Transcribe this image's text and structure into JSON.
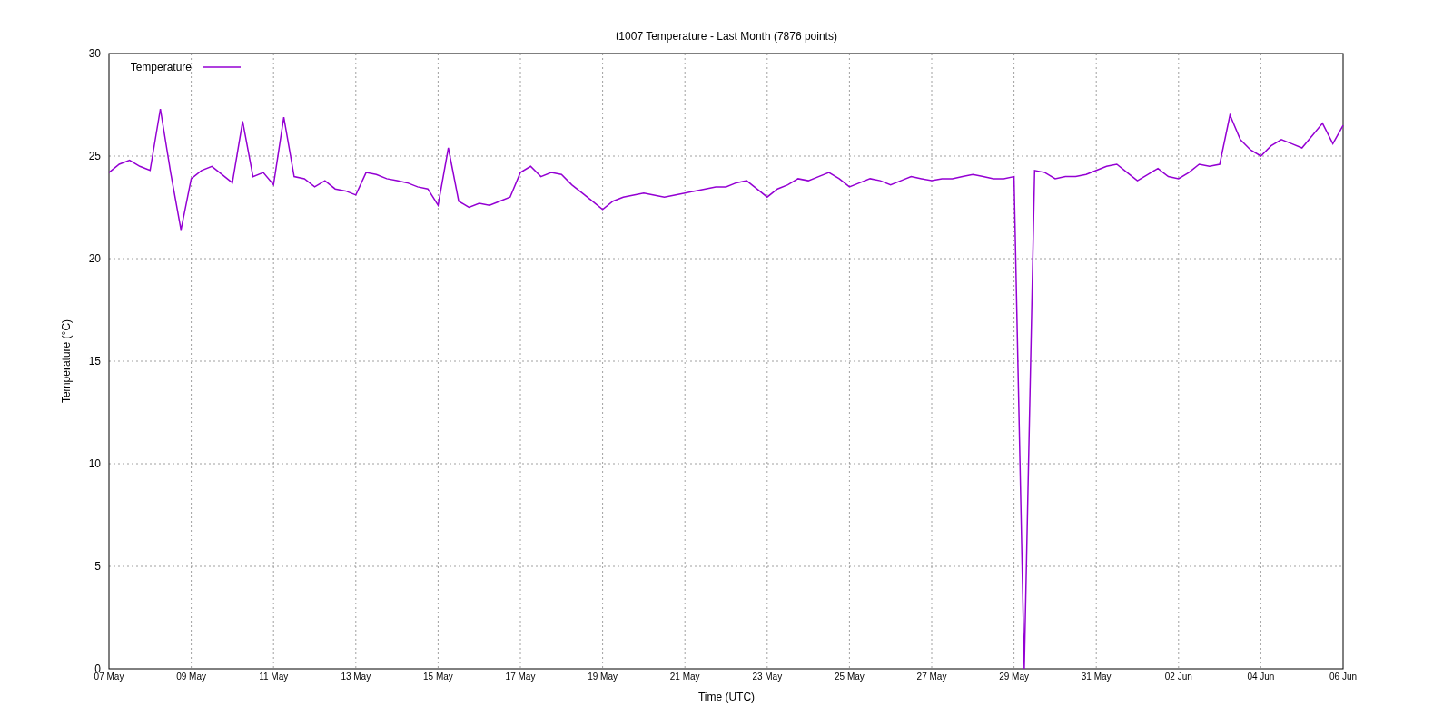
{
  "chart_data": {
    "type": "line",
    "title": "t1007 Temperature - Last Month (7876 points)",
    "xlabel": "Time (UTC)",
    "ylabel": "Temperature (°C)",
    "categories": [
      "07 May",
      null,
      null,
      null,
      null,
      null,
      null,
      null,
      "09 May",
      null,
      null,
      null,
      null,
      null,
      null,
      null,
      "11 May",
      null,
      null,
      null,
      null,
      null,
      null,
      null,
      "13 May",
      null,
      null,
      null,
      null,
      null,
      null,
      null,
      "15 May",
      null,
      null,
      null,
      null,
      null,
      null,
      null,
      "17 May",
      null,
      null,
      null,
      null,
      null,
      null,
      null,
      "19 May",
      null,
      null,
      null,
      null,
      null,
      null,
      null,
      "21 May",
      null,
      null,
      null,
      null,
      null,
      null,
      null,
      "23 May",
      null,
      null,
      null,
      null,
      null,
      null,
      null,
      "25 May",
      null,
      null,
      null,
      null,
      null,
      null,
      null,
      "27 May",
      null,
      null,
      null,
      null,
      null,
      null,
      null,
      "29 May",
      null,
      null,
      null,
      null,
      null,
      null,
      null,
      "31 May",
      null,
      null,
      null,
      null,
      null,
      null,
      null,
      "02 Jun",
      null,
      null,
      null,
      null,
      null,
      null,
      null,
      "04 Jun",
      null,
      null,
      null,
      null,
      null,
      null,
      null,
      "06 Jun"
    ],
    "ylim": [
      0,
      30
    ],
    "grid": true,
    "yticks": [
      0,
      5,
      10,
      15,
      20,
      25,
      30
    ],
    "series": [
      {
        "name": "Temperature",
        "color": "#9400d3",
        "values": [
          24.2,
          24.6,
          24.8,
          24.5,
          24.3,
          27.3,
          24.2,
          21.4,
          23.9,
          24.3,
          24.5,
          24.1,
          23.7,
          26.7,
          24.0,
          24.2,
          23.6,
          26.9,
          24.0,
          23.9,
          23.5,
          23.8,
          23.4,
          23.3,
          23.1,
          24.2,
          24.1,
          23.9,
          23.8,
          23.7,
          23.5,
          23.4,
          22.6,
          25.4,
          22.8,
          22.5,
          22.7,
          22.6,
          22.8,
          23.0,
          24.2,
          24.5,
          24.0,
          24.2,
          24.1,
          23.6,
          23.2,
          22.8,
          22.4,
          22.8,
          23.0,
          23.1,
          23.2,
          23.1,
          23.0,
          23.1,
          23.2,
          23.3,
          23.4,
          23.5,
          23.5,
          23.7,
          23.8,
          23.4,
          23.0,
          23.4,
          23.6,
          23.9,
          23.8,
          24.0,
          24.2,
          23.9,
          23.5,
          23.7,
          23.9,
          23.8,
          23.6,
          23.8,
          24.0,
          23.9,
          23.8,
          23.9,
          23.9,
          24.0,
          24.1,
          24.0,
          23.9,
          23.9,
          24.0,
          0,
          24.3,
          24.2,
          23.9,
          24.0,
          24.0,
          24.1,
          24.3,
          24.5,
          24.6,
          24.2,
          23.8,
          24.1,
          24.4,
          24.0,
          23.9,
          24.2,
          24.6,
          24.5,
          24.6,
          27.0,
          25.8,
          25.3,
          25.0,
          25.5,
          25.8,
          25.6,
          25.4,
          26.0,
          26.6,
          25.6,
          26.5
        ]
      }
    ]
  }
}
